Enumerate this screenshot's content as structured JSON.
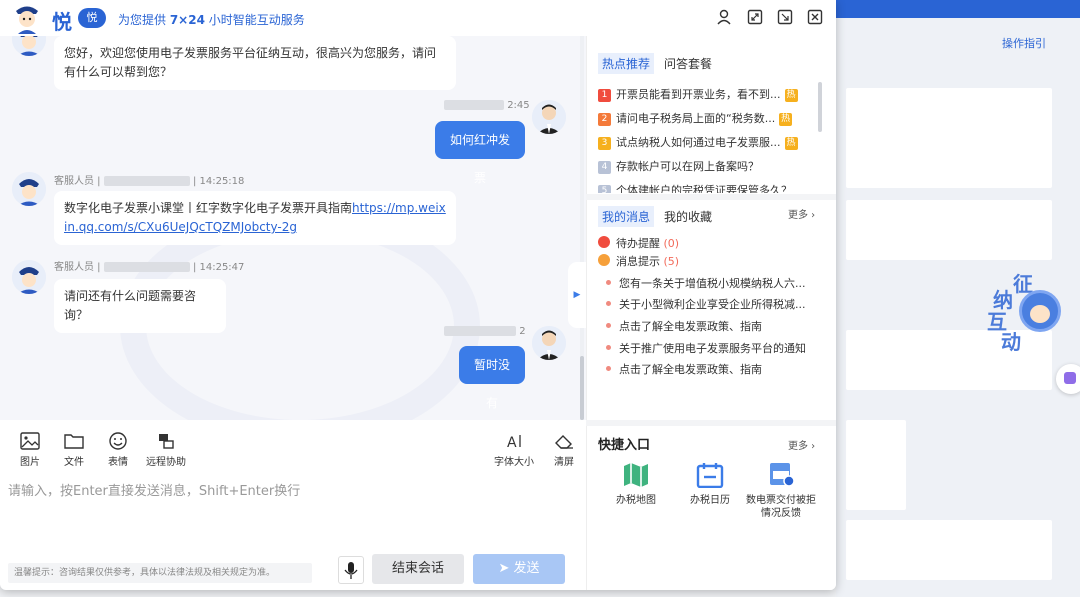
{
  "background": {
    "guide_link": "操作指引",
    "mascot_chars": [
      "征",
      "纳",
      "互",
      "动"
    ]
  },
  "header": {
    "logo_text": "悦",
    "logo_badge": "悦",
    "slogan_prefix": "为您提供 ",
    "slogan_bold": "7×24",
    "slogan_suffix": " 小时智能互动服务",
    "icons": [
      "user-icon",
      "fullscreen-icon",
      "exit-window-icon",
      "close-icon"
    ]
  },
  "chat": {
    "messages": [
      {
        "role": "agent",
        "text": "您好，欢迎您使用电子发票服务平台征纳互动，很高兴为您服务，请问有什么可以帮到您？"
      },
      {
        "role": "user",
        "time": "2:45",
        "text": "如何红冲发票"
      },
      {
        "role": "agent",
        "sender": "客服人员 |",
        "time": "| 14:25:18",
        "text": "数字化电子发票小课堂丨红字数字化电子发票开具指南",
        "link": "https://mp.weixin.qq.com/s/CXu6UeJQcTQZMJobcty-2g"
      },
      {
        "role": "agent",
        "sender": "客服人员 |",
        "time": "| 14:25:47",
        "text": "请问还有什么问题需要咨询？"
      },
      {
        "role": "user",
        "time": "2",
        "text": "暂时没有"
      }
    ]
  },
  "toolbar": {
    "image": "图片",
    "file": "文件",
    "emoji": "表情",
    "remote": "远程协助",
    "font_size": "字体大小",
    "clear": "清屏"
  },
  "input": {
    "placeholder": "请输入，按Enter直接发送消息，Shift+Enter换行"
  },
  "footer": {
    "tip": "温馨提示：咨询结果仅供参考，具体以法律法规及相关规定为准。",
    "end_label": "结束会话",
    "send_label": "发送"
  },
  "panel": {
    "tab_hot": "热点推荐",
    "tab_package": "问答套餐",
    "hot_items": [
      {
        "num": "1",
        "text": "开票员能看到开票业务，看不到...",
        "hot": "热",
        "color": "#f04c3e"
      },
      {
        "num": "2",
        "text": "请问电子税务局上面的“税务数...",
        "hot": "热",
        "color": "#f47a3a"
      },
      {
        "num": "3",
        "text": "试点纳税人如何通过电子发票服...",
        "hot": "热",
        "color": "#f6b01e"
      },
      {
        "num": "4",
        "text": "存款帐户可以在网上备案吗？",
        "hot": "",
        "color": "#b8c2d6"
      },
      {
        "num": "5",
        "text": "个体建帐户的完税凭证要保管多久？",
        "hot": "",
        "color": "#b8c2d6"
      }
    ],
    "tab_messages": "我的消息",
    "tab_favorites": "我的收藏",
    "more": "更多",
    "pending_label": "待办提醒",
    "pending_count": "(0)",
    "notice_label": "消息提示",
    "notice_count": "(5)",
    "notices": [
      "您有一条关于增值税小规模纳税人六...",
      "关于小型微利企业享受企业所得税减...",
      "点击了解全电发票政策、指南",
      "关于推广使用电子发票服务平台的通知",
      "点击了解全电发票政策、指南"
    ],
    "quick_title": "快捷入口",
    "quick_more": "更多",
    "quick_items": [
      {
        "label": "办税地图"
      },
      {
        "label": "办税日历"
      },
      {
        "label": "数电票交付被拒情况反馈"
      }
    ]
  },
  "colors": {
    "brand": "#2a64d4",
    "user_bubble": "#3b7ce8",
    "send_disabled": "#a9c7f5"
  }
}
